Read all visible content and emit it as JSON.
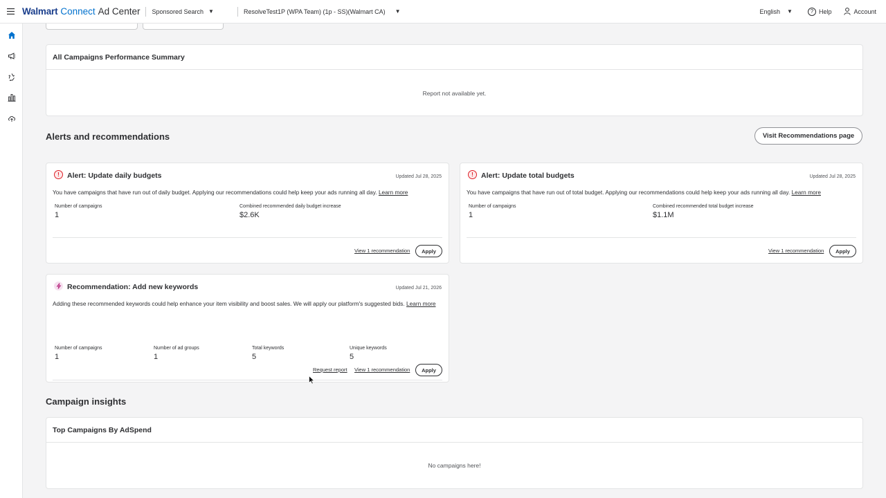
{
  "header": {
    "brand_walmart": "Walmart",
    "brand_connect": "Connect",
    "brand_adcenter": "Ad Center",
    "product_selector": "Sponsored Search",
    "advertiser_selector": "ResolveTest1P (WPA Team) (1p - SS)(Walmart CA)",
    "language": "English",
    "help": "Help",
    "account": "Account"
  },
  "sidebar": {
    "items": [
      {
        "icon": "home-icon"
      },
      {
        "icon": "megaphone-icon"
      },
      {
        "icon": "recycle-icon"
      },
      {
        "icon": "bar-chart-icon"
      },
      {
        "icon": "cloud-upload-icon"
      }
    ]
  },
  "performance_summary": {
    "title": "All Campaigns Performance Summary",
    "empty": "Report not available yet."
  },
  "alerts_section": {
    "title": "Alerts and recommendations",
    "visit_button": "Visit Recommendations page"
  },
  "alert_daily": {
    "title": "Alert: Update daily budgets",
    "updated": "Updated Jul 28, 2025",
    "description": "You have campaigns that have run out of daily budget. Applying our recommendations could help keep your ads running all day.",
    "learn_more": "Learn more",
    "metric1_label": "Number of campaigns",
    "metric1_value": "1",
    "metric2_label": "Combined recommended daily budget increase",
    "metric2_value": "$2.6K",
    "view_link": "View 1 recommendation",
    "apply": "Apply"
  },
  "alert_total": {
    "title": "Alert: Update total budgets",
    "updated": "Updated Jul 28, 2025",
    "description": "You have campaigns that have run out of total budget. Applying our recommendations could help keep your ads running all day.",
    "learn_more": "Learn more",
    "metric1_label": "Number of campaigns",
    "metric1_value": "1",
    "metric2_label": "Combined recommended total budget increase",
    "metric2_value": "$1.1M",
    "view_link": "View 1 recommendation",
    "apply": "Apply"
  },
  "rec_keywords": {
    "title": "Recommendation: Add new keywords",
    "updated": "Updated Jul 21, 2026",
    "description": "Adding these recommended keywords could help enhance your item visibility and boost sales. We will apply our platform's suggested bids.",
    "learn_more": "Learn more",
    "metrics": [
      {
        "label": "Number of campaigns",
        "value": "1"
      },
      {
        "label": "Number of ad groups",
        "value": "1"
      },
      {
        "label": "Total keywords",
        "value": "5"
      },
      {
        "label": "Unique keywords",
        "value": "5"
      }
    ],
    "request_report": "Request report",
    "view_link": "View 1 recommendation",
    "apply": "Apply"
  },
  "insights": {
    "title": "Campaign insights",
    "top_campaigns_title": "Top Campaigns By AdSpend",
    "empty": "No campaigns here!"
  },
  "colors": {
    "brand_dark": "#1a3e8c",
    "brand_blue": "#0071ce",
    "alert_red": "#de1c24",
    "rec_pink": "#b5267c"
  }
}
